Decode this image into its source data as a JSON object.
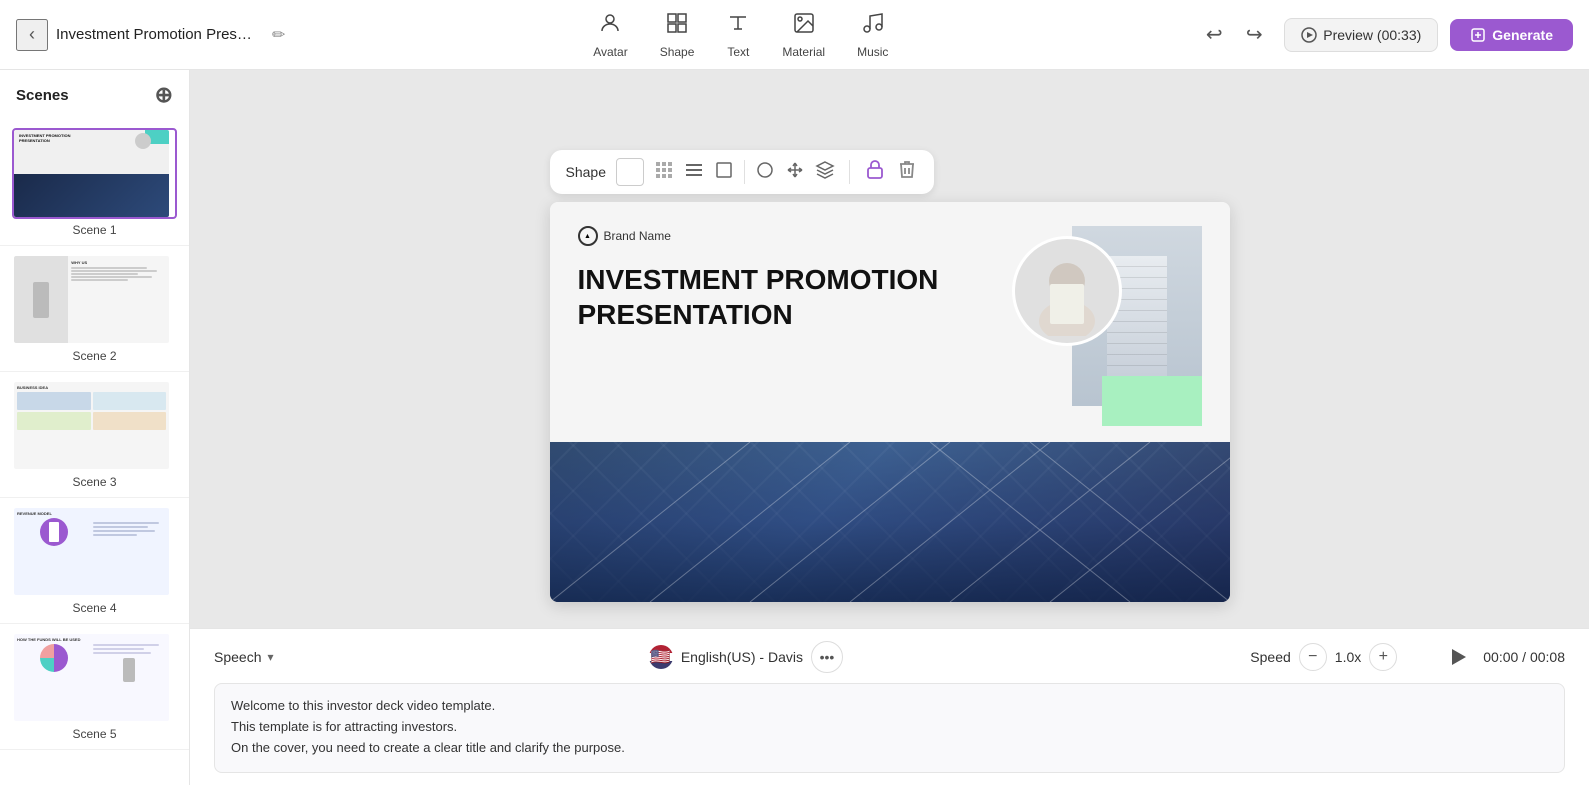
{
  "app": {
    "title": "Investment Promotion Prese...",
    "edit_icon": "✏️"
  },
  "toolbar": {
    "back_label": "‹",
    "items": [
      {
        "id": "avatar",
        "label": "Avatar",
        "icon": "👤"
      },
      {
        "id": "shape",
        "label": "Shape",
        "icon": "⬡"
      },
      {
        "id": "text",
        "label": "Text",
        "icon": "T"
      },
      {
        "id": "material",
        "label": "Material",
        "icon": "🖼"
      },
      {
        "id": "music",
        "label": "Music",
        "icon": "♫"
      }
    ],
    "undo_label": "↩",
    "redo_label": "↪",
    "preview_label": "Preview (00:33)",
    "generate_label": "Generate"
  },
  "scenes_panel": {
    "title": "Scenes",
    "add_icon": "+",
    "scenes": [
      {
        "id": 1,
        "label": "Scene 1",
        "active": true
      },
      {
        "id": 2,
        "label": "Scene 2",
        "active": false
      },
      {
        "id": 3,
        "label": "Scene 3",
        "active": false
      },
      {
        "id": 4,
        "label": "Scene 4",
        "active": false
      },
      {
        "id": 5,
        "label": "Scene 5",
        "active": false
      }
    ]
  },
  "shape_toolbar": {
    "label": "Shape",
    "icons": [
      "color",
      "pattern",
      "lines",
      "crop",
      "circle-crop",
      "move",
      "layers"
    ],
    "lock_icon": "🔒",
    "delete_icon": "🗑"
  },
  "slide": {
    "brand_name": "Brand Name",
    "title_line1": "INVESTMENT PROMOTION",
    "title_line2": "PRESENTATION"
  },
  "speech_panel": {
    "speech_label": "Speech",
    "language": "English(US) - Davis",
    "speed_label": "Speed",
    "speed_value": "1.0x",
    "time_display": "00:00 / 00:08",
    "speech_text_line1": "Welcome to this investor deck video template.",
    "speech_text_line2": "This template is for attracting investors.",
    "speech_text_line3": "On the cover, you need to create a clear title and clarify the purpose."
  },
  "colors": {
    "accent": "#9b59d0",
    "teal": "#4dd0c4",
    "green": "#a8f0c0"
  }
}
